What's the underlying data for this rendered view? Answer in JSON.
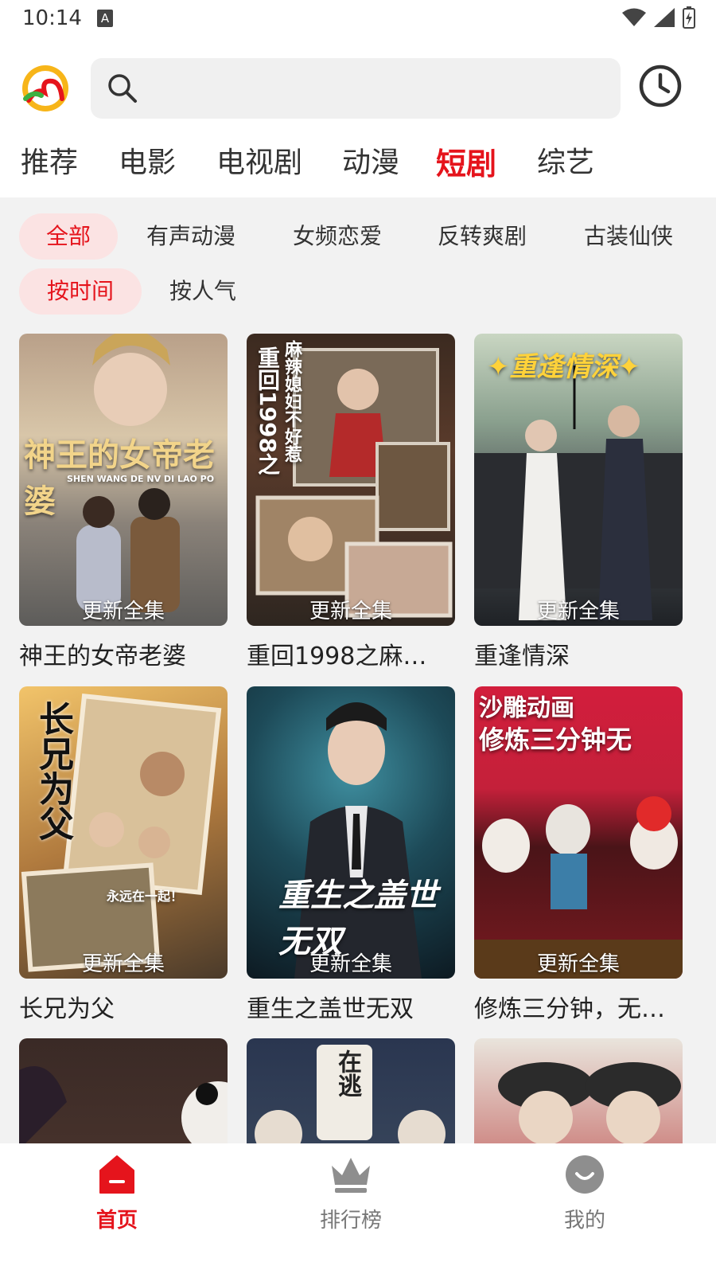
{
  "status": {
    "time": "10:14",
    "indicator": "A"
  },
  "header": {
    "search_placeholder": "",
    "logo_icon": "app-logo",
    "history_icon": "clock-icon"
  },
  "tabs": [
    {
      "label": "推荐",
      "active": false
    },
    {
      "label": "电影",
      "active": false
    },
    {
      "label": "电视剧",
      "active": false
    },
    {
      "label": "动漫",
      "active": false
    },
    {
      "label": "短剧",
      "active": true
    },
    {
      "label": "综艺",
      "active": false
    }
  ],
  "filters": {
    "genres": [
      {
        "label": "全部",
        "active": true
      },
      {
        "label": "有声动漫",
        "active": false
      },
      {
        "label": "女频恋爱",
        "active": false
      },
      {
        "label": "反转爽剧",
        "active": false
      },
      {
        "label": "古装仙侠",
        "active": false
      }
    ],
    "sort": [
      {
        "label": "按时间",
        "active": true
      },
      {
        "label": "按人气",
        "active": false
      }
    ]
  },
  "cards": [
    {
      "title": "神王的女帝老婆",
      "badge": "更新全集",
      "poster_text": "神王的女帝老婆",
      "poster_sub": "SHEN WANG DE NV DI LAO PO"
    },
    {
      "title": "重回1998之麻…",
      "badge": "更新全集",
      "poster_text": "重回1998之",
      "poster_sub": "麻辣媳妇不好惹"
    },
    {
      "title": "重逢情深",
      "badge": "更新全集",
      "poster_text": "✦重逢情深✦",
      "poster_sub": ""
    },
    {
      "title": "长兄为父",
      "badge": "更新全集",
      "poster_text": "长兄为父",
      "poster_sub": "永远在一起！"
    },
    {
      "title": "重生之盖世无双",
      "badge": "更新全集",
      "poster_text": "重生之盖世无双",
      "poster_sub": ""
    },
    {
      "title": "修炼三分钟，无…",
      "badge": "更新全集",
      "poster_text": "沙雕动画",
      "poster_sub": "修炼三分钟无"
    },
    {
      "title": "",
      "badge": "",
      "poster_text": "",
      "poster_sub": ""
    },
    {
      "title": "",
      "badge": "",
      "poster_text": "在逃",
      "poster_sub": ""
    },
    {
      "title": "",
      "badge": "",
      "poster_text": "",
      "poster_sub": ""
    }
  ],
  "bottom_nav": [
    {
      "label": "首页",
      "icon": "home-icon",
      "active": true
    },
    {
      "label": "排行榜",
      "icon": "crown-icon",
      "active": false
    },
    {
      "label": "我的",
      "icon": "smiley-icon",
      "active": false
    }
  ],
  "colors": {
    "accent": "#e5141c",
    "chip_active_bg": "#fbe3e3"
  }
}
